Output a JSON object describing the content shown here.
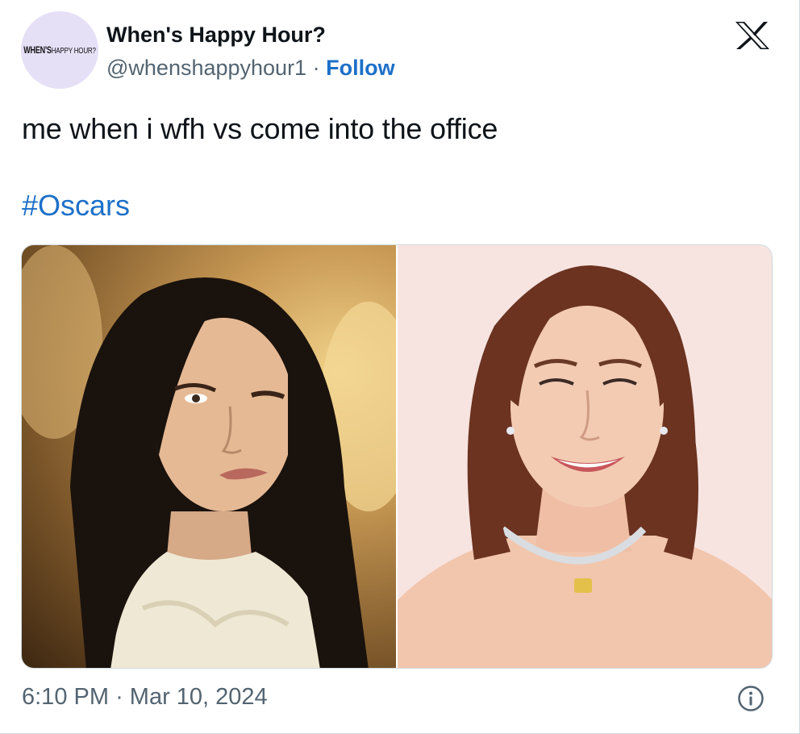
{
  "tweet": {
    "avatar": {
      "brand_bold": "WHEN'S",
      "brand_thin": "HAPPY HOUR?"
    },
    "author": {
      "display_name": "When's Happy Hour?",
      "handle": "@whenshappyhour1",
      "separator": "·",
      "follow_label": "Follow"
    },
    "platform_icon": "x-logo-icon",
    "text": "me when i wfh vs come into the office",
    "hashtag": "#Oscars",
    "media": [
      {
        "kind": "photo",
        "subject": "woman-winking-dark-hair"
      },
      {
        "kind": "photo",
        "subject": "woman-smiling-red-carpet"
      }
    ],
    "timestamp": {
      "time": "6:10 PM",
      "separator": "·",
      "date": "Mar 10, 2024"
    },
    "info_icon": "info-icon"
  },
  "colors": {
    "link": "#1d70c9",
    "text_primary": "#0f1419",
    "text_secondary": "#536471",
    "border": "#cfd9de",
    "avatar_bg": "#e6e0f7"
  }
}
